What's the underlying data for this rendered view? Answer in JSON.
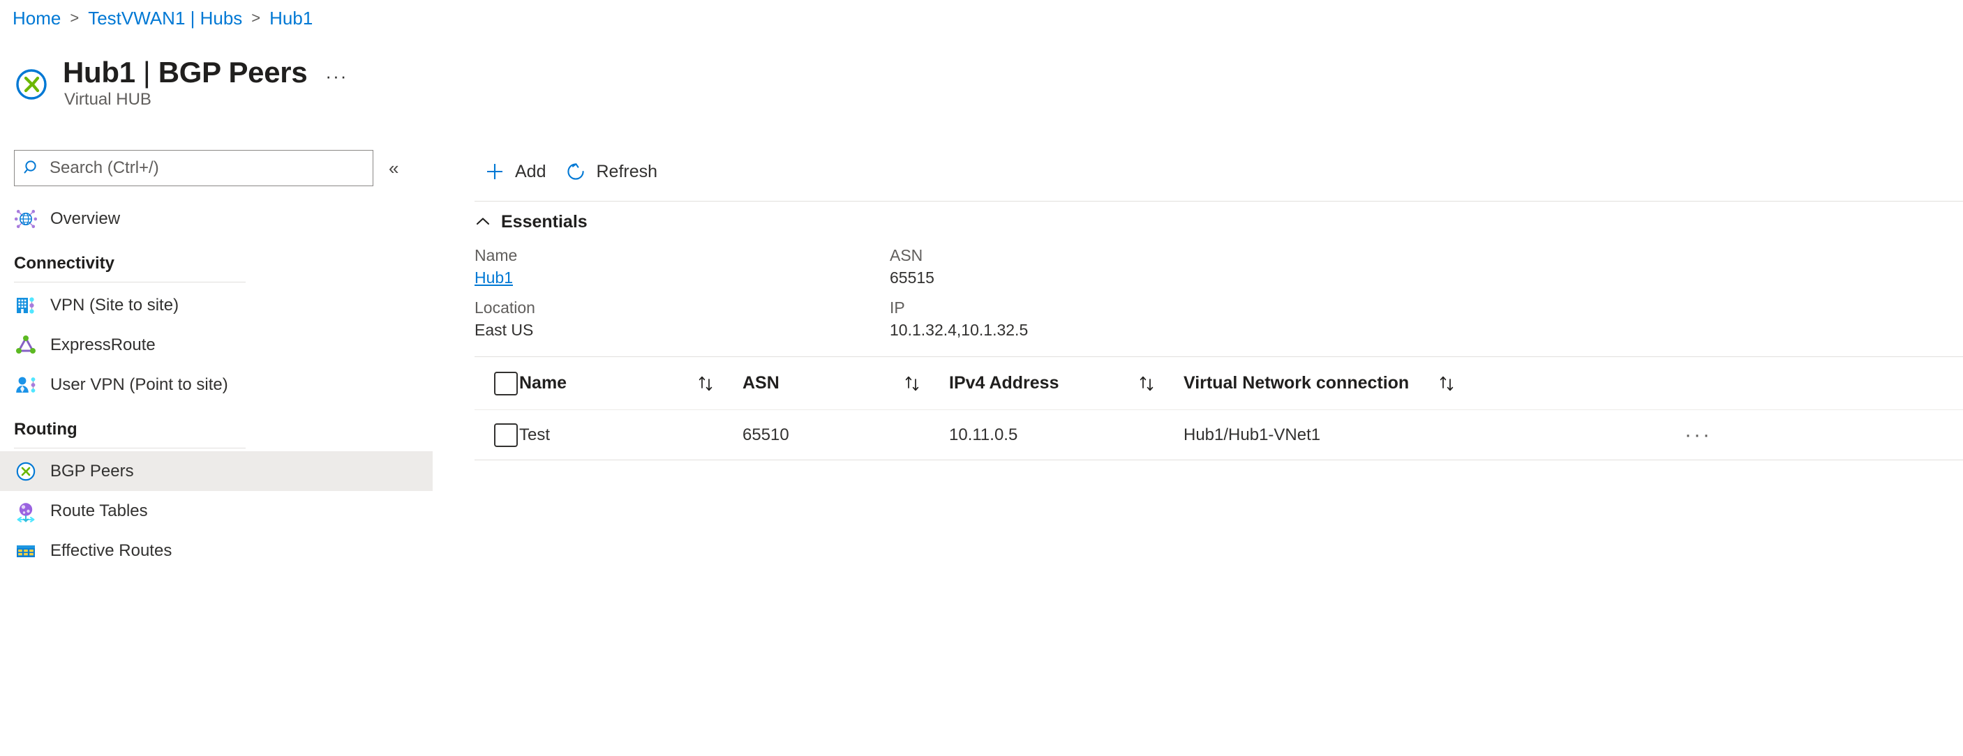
{
  "breadcrumb": {
    "items": [
      {
        "label": "Home"
      },
      {
        "label": "TestVWAN1 | Hubs"
      },
      {
        "label": "Hub1"
      }
    ],
    "separator": ">"
  },
  "header": {
    "resource_name": "Hub1",
    "pipe": "|",
    "section": "BGP Peers",
    "subtitle": "Virtual HUB",
    "more_label": "···",
    "icon": "virtual-hub-icon"
  },
  "sidebar": {
    "search": {
      "placeholder": "Search (Ctrl+/)",
      "value": "",
      "icon": "search-icon"
    },
    "collapse_label": "«",
    "top_items": [
      {
        "label": "Overview",
        "icon": "overview-globe-icon",
        "selected": false
      }
    ],
    "groups": [
      {
        "title": "Connectivity",
        "items": [
          {
            "label": "VPN (Site to site)",
            "icon": "vpn-site-to-site-icon",
            "selected": false
          },
          {
            "label": "ExpressRoute",
            "icon": "expressroute-icon",
            "selected": false
          },
          {
            "label": "User VPN (Point to site)",
            "icon": "user-vpn-point-to-site-icon",
            "selected": false
          }
        ]
      },
      {
        "title": "Routing",
        "items": [
          {
            "label": "BGP Peers",
            "icon": "bgp-peers-icon",
            "selected": true
          },
          {
            "label": "Route Tables",
            "icon": "route-tables-icon",
            "selected": false
          },
          {
            "label": "Effective Routes",
            "icon": "effective-routes-icon",
            "selected": false
          }
        ]
      }
    ]
  },
  "toolbar": {
    "add_label": "Add",
    "add_icon": "plus-icon",
    "refresh_label": "Refresh",
    "refresh_icon": "refresh-icon"
  },
  "essentials": {
    "title": "Essentials",
    "collapse_icon": "chevron-up-icon",
    "fields": [
      {
        "key": "Name",
        "value": "Hub1",
        "is_link": true
      },
      {
        "key": "ASN",
        "value": "65515",
        "is_link": false
      },
      {
        "key": "Location",
        "value": "East US",
        "is_link": false
      },
      {
        "key": "IP",
        "value": "10.1.32.4,10.1.32.5",
        "is_link": false
      }
    ]
  },
  "table": {
    "columns": [
      {
        "label": "Name",
        "sortable": true
      },
      {
        "label": "ASN",
        "sortable": true
      },
      {
        "label": "IPv4 Address",
        "sortable": true
      },
      {
        "label": "Virtual Network connection",
        "sortable": true
      }
    ],
    "sort_icon": "sort-ascending-descending-icon",
    "row_menu_label": "···",
    "rows": [
      {
        "checked": false,
        "name": "Test",
        "asn": "65510",
        "ipv4": "10.11.0.5",
        "vnet_connection": "Hub1/Hub1-VNet1"
      }
    ]
  },
  "colors": {
    "link": "#0078d4",
    "accent": "#0078d4",
    "text": "#323130",
    "muted": "#605e5c",
    "selected_bg": "#edebe9",
    "divider": "#e1dfdd"
  }
}
